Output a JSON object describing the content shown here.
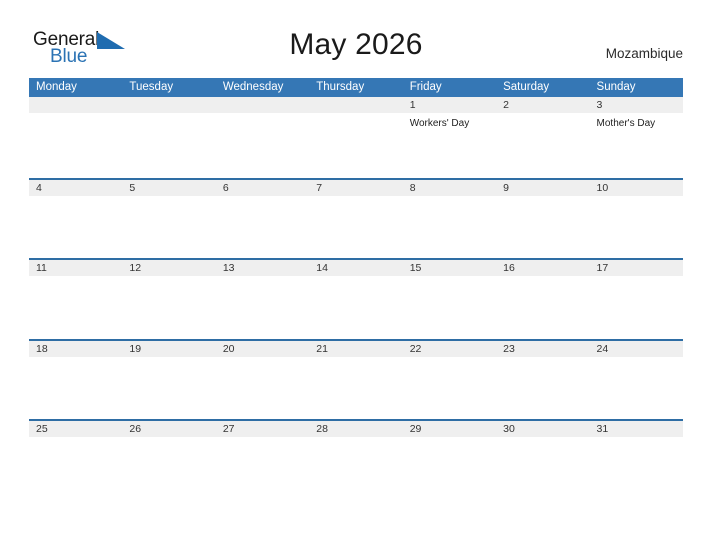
{
  "logo": {
    "word_one": "General",
    "word_two": "Blue",
    "flag_icon": "blue-flag-triangle",
    "word_one_color": "#1a1a1a",
    "word_two_color": "#2b73b4",
    "flag_color": "#1f6cb0"
  },
  "header": {
    "title": "May 2026",
    "country": "Mozambique"
  },
  "theme": {
    "header_blue": "#3577b5",
    "row_border_blue": "#2e6da4",
    "band_gray": "#efefef",
    "text_dark": "#333333",
    "page_background": "#ffffff"
  },
  "calendar": {
    "weekday_headers": [
      "Monday",
      "Tuesday",
      "Wednesday",
      "Thursday",
      "Friday",
      "Saturday",
      "Sunday"
    ],
    "weeks": [
      [
        {
          "date": "",
          "event": ""
        },
        {
          "date": "",
          "event": ""
        },
        {
          "date": "",
          "event": ""
        },
        {
          "date": "",
          "event": ""
        },
        {
          "date": "1",
          "event": "Workers' Day"
        },
        {
          "date": "2",
          "event": ""
        },
        {
          "date": "3",
          "event": "Mother's Day"
        }
      ],
      [
        {
          "date": "4",
          "event": ""
        },
        {
          "date": "5",
          "event": ""
        },
        {
          "date": "6",
          "event": ""
        },
        {
          "date": "7",
          "event": ""
        },
        {
          "date": "8",
          "event": ""
        },
        {
          "date": "9",
          "event": ""
        },
        {
          "date": "10",
          "event": ""
        }
      ],
      [
        {
          "date": "11",
          "event": ""
        },
        {
          "date": "12",
          "event": ""
        },
        {
          "date": "13",
          "event": ""
        },
        {
          "date": "14",
          "event": ""
        },
        {
          "date": "15",
          "event": ""
        },
        {
          "date": "16",
          "event": ""
        },
        {
          "date": "17",
          "event": ""
        }
      ],
      [
        {
          "date": "18",
          "event": ""
        },
        {
          "date": "19",
          "event": ""
        },
        {
          "date": "20",
          "event": ""
        },
        {
          "date": "21",
          "event": ""
        },
        {
          "date": "22",
          "event": ""
        },
        {
          "date": "23",
          "event": ""
        },
        {
          "date": "24",
          "event": ""
        }
      ],
      [
        {
          "date": "25",
          "event": ""
        },
        {
          "date": "26",
          "event": ""
        },
        {
          "date": "27",
          "event": ""
        },
        {
          "date": "28",
          "event": ""
        },
        {
          "date": "29",
          "event": ""
        },
        {
          "date": "30",
          "event": ""
        },
        {
          "date": "31",
          "event": ""
        }
      ]
    ]
  }
}
